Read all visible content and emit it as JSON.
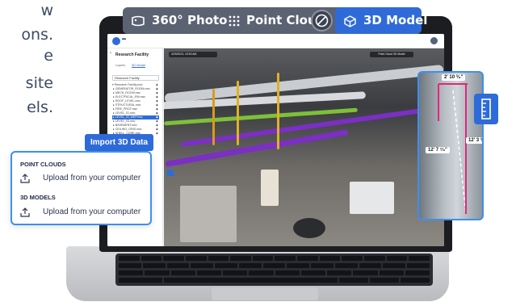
{
  "hero": {
    "lines": [
      "w",
      "ons.",
      "e",
      "site",
      "els."
    ]
  },
  "mode_switch": {
    "items": [
      {
        "label": "360° Photo",
        "icon": "panorama-icon"
      },
      {
        "label": "Point Cloud",
        "icon": "grid-dots-icon"
      },
      {
        "label": "3D Model",
        "icon": "cube-icon",
        "active": true
      }
    ],
    "toggle_icon": "overlap-circles-icon"
  },
  "app": {
    "project_name": "Research Facility",
    "tabs": [
      "Layers",
      "3D Model"
    ],
    "active_tab": "3D Model",
    "tree_filter": "Research Facility",
    "tree_items": [
      {
        "label": "Research Facility.nwc",
        "selected": false
      },
      {
        "label": "GENERATOR_ROOM.nwc",
        "selected": false
      },
      {
        "label": "MECH_ROOM.nwc",
        "selected": false
      },
      {
        "label": "ELECTRICAL_RM.nwc",
        "selected": false
      },
      {
        "label": "ROOF_LEVEL.nwc",
        "selected": false
      },
      {
        "label": "STRUCTURAL.nwc",
        "selected": false
      },
      {
        "label": "FIRE_PROT.nwc",
        "selected": false
      },
      {
        "label": "LEVEL_01.nwc",
        "selected": false
      },
      {
        "label": "LEVEL_02_MEP.nwc",
        "selected": true
      },
      {
        "label": "LEVEL_03.nwc",
        "selected": false
      },
      {
        "label": "BASEMENT.nwc",
        "selected": false
      },
      {
        "label": "CEILING_GRID.nwc",
        "selected": false
      },
      {
        "label": "SHELL_CORE.nwc",
        "selected": false
      }
    ],
    "viewport_toolbar": "3/29/2023, 10:53 AM",
    "viewport_right": "Point Cloud   3D Model"
  },
  "measurements": {
    "top": "2' 10 ³⁄₈\"",
    "left": "12' 7 ⁷⁄₈\"",
    "right": "12' 3 ³⁄₄\""
  },
  "import_button": {
    "label": "Import 3D Data"
  },
  "import_card": {
    "sections": [
      {
        "title": "POINT CLOUDS",
        "action": "Upload from your computer"
      },
      {
        "title": "3D MODELS",
        "action": "Upload from your computer"
      }
    ]
  },
  "colors": {
    "accent": "#2f6bd8",
    "accent_border": "#3d8ff0",
    "mode_bar": "#5b6272",
    "pipe_purple": "#7b2fc4",
    "pipe_green": "#7fbf3a"
  }
}
